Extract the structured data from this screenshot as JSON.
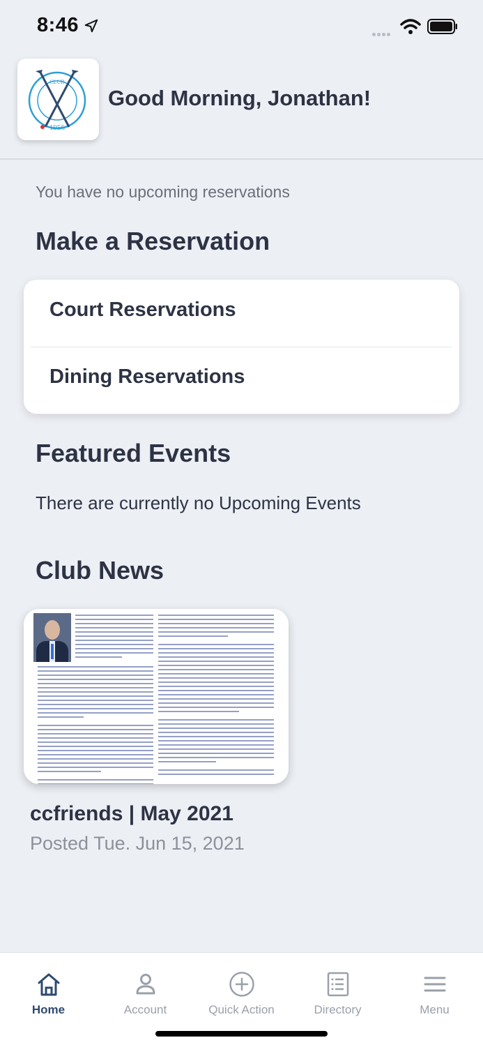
{
  "status_bar": {
    "time": "8:46"
  },
  "header": {
    "logo_text": "THE COUNTRY CLUB OF FLORIDA",
    "logo_year": "1956",
    "greeting": "Good Morning, Jonathan!"
  },
  "reservations": {
    "none_message": "You have no upcoming reservations",
    "section_title": "Make a Reservation",
    "items": [
      {
        "label": "Court Reservations"
      },
      {
        "label": "Dining Reservations"
      }
    ]
  },
  "events": {
    "section_title": "Featured Events",
    "none_message": "There are currently no Upcoming Events"
  },
  "news": {
    "section_title": "Club News",
    "items": [
      {
        "title": "ccfriends | May 2021",
        "date": "Posted Tue. Jun 15, 2021"
      }
    ]
  },
  "tab_bar": {
    "active": "Home",
    "tabs": [
      {
        "label": "Home",
        "icon": "home-icon"
      },
      {
        "label": "Account",
        "icon": "person-icon"
      },
      {
        "label": "Quick Action",
        "icon": "plus-circle-icon"
      },
      {
        "label": "Directory",
        "icon": "list-icon"
      },
      {
        "label": "Menu",
        "icon": "hamburger-icon"
      }
    ]
  },
  "colors": {
    "background": "#eceff4",
    "text": "#2d3344",
    "active_tab": "#2f4a6e",
    "inactive_tab": "#9aa0aa",
    "logo_blue": "#2a9fd6"
  }
}
